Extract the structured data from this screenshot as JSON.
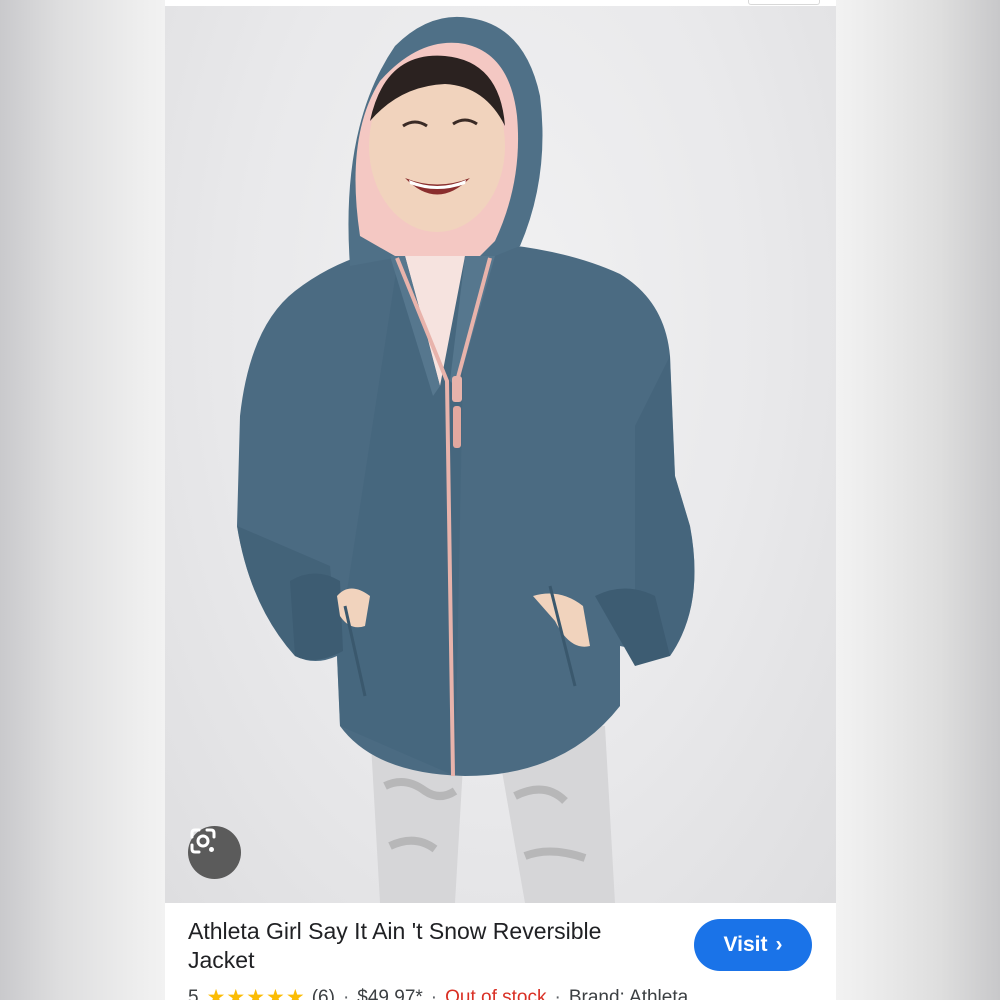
{
  "product": {
    "title": "Athleta Girl Say It Ain 't Snow Reversible Jacket",
    "rating": "5",
    "stars": "★★★★★",
    "review_count": "(6)",
    "price": "$49.97*",
    "stock_status": "Out of stock",
    "brand": "Brand: Athleta",
    "separator": "·"
  },
  "actions": {
    "visit_label": "Visit",
    "visit_chevron": "›"
  },
  "icons": {
    "lens": "google-lens-icon"
  },
  "colors": {
    "jacket": "#4b6b82",
    "hood_lining": "#f6cbc6",
    "visit_button": "#1a73e8",
    "stock_red": "#d93025",
    "star": "#fbbc04"
  }
}
